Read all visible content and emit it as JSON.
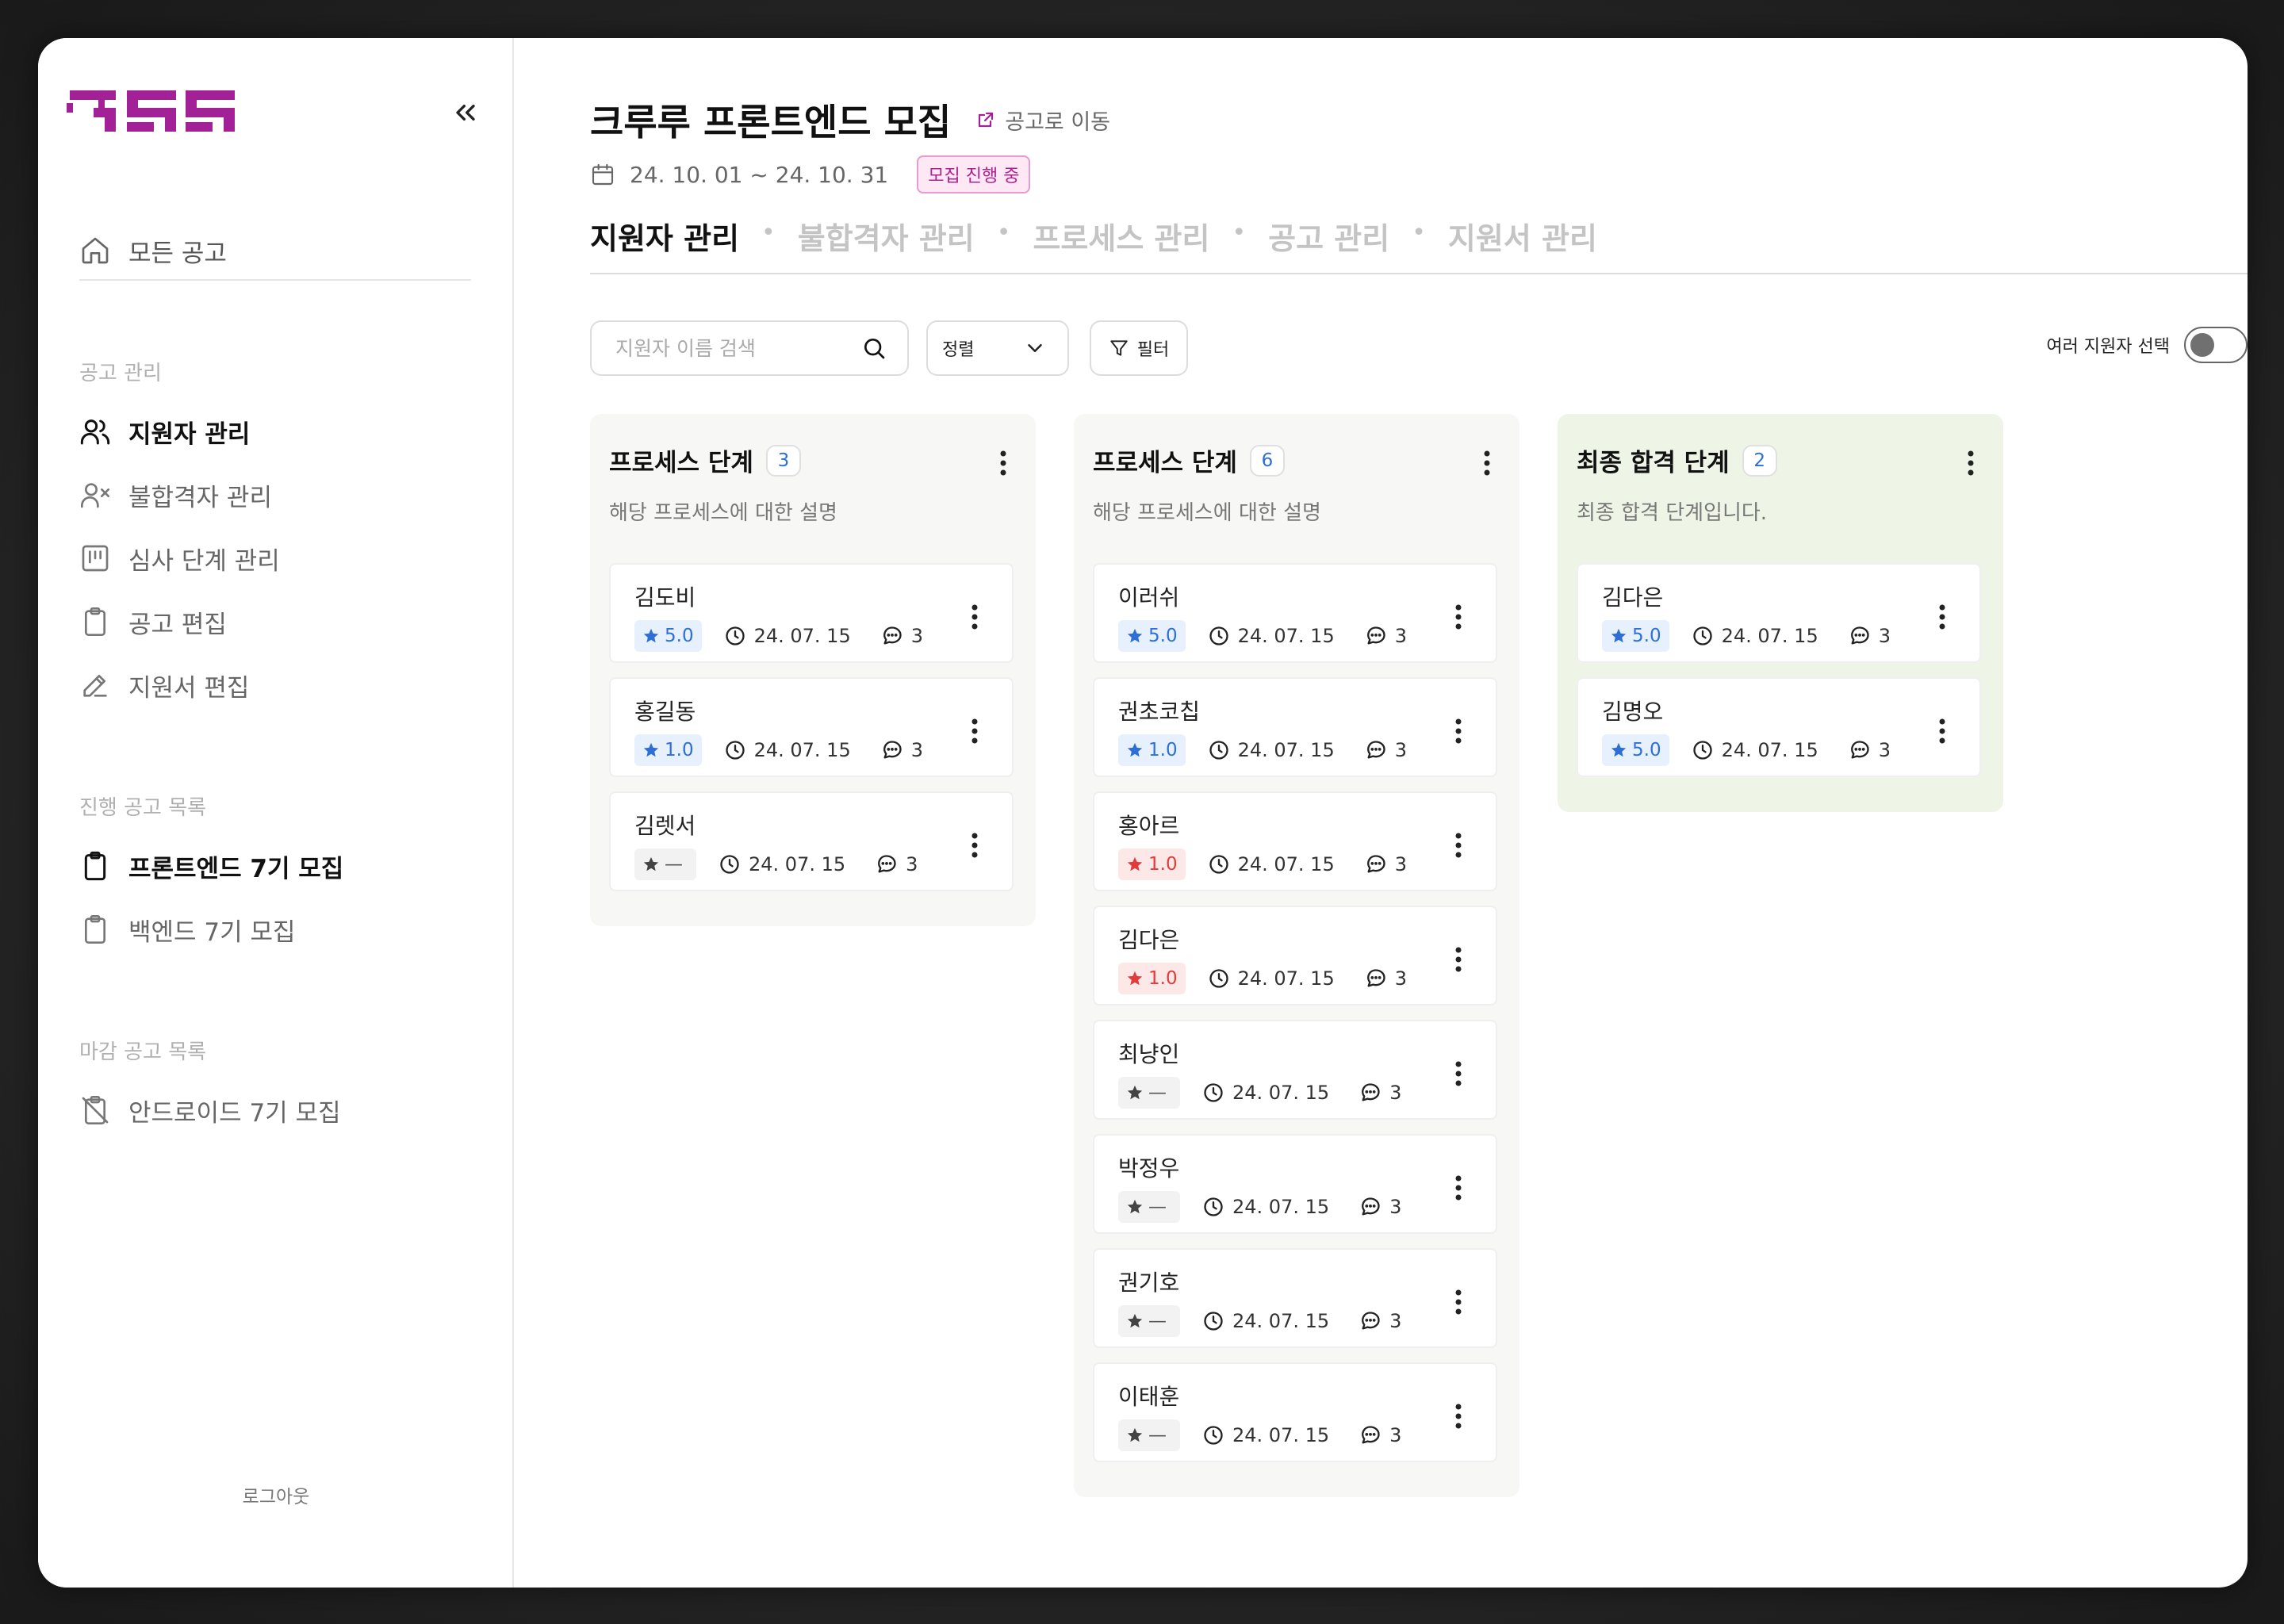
{
  "app": {
    "brand_color": "#a32196",
    "logo_label": "크루루"
  },
  "sidebar": {
    "collapse_icon": "double-chevron-left-icon",
    "home": {
      "label": "모든 공고",
      "icon": "home-icon"
    },
    "sections": [
      {
        "label": "공고 관리",
        "items": [
          {
            "label": "지원자 관리",
            "icon": "users-icon",
            "active": true
          },
          {
            "label": "불합격자 관리",
            "icon": "user-x-icon"
          },
          {
            "label": "심사 단계 관리",
            "icon": "kanban-icon"
          },
          {
            "label": "공고 편집",
            "icon": "clipboard-icon"
          },
          {
            "label": "지원서 편집",
            "icon": "pencil-icon"
          }
        ]
      },
      {
        "label": "진행 공고 목록",
        "items": [
          {
            "label": "프론트엔드 7기 모집",
            "icon": "clipboard-icon",
            "active": true
          },
          {
            "label": "백엔드 7기 모집",
            "icon": "clipboard-icon"
          }
        ]
      },
      {
        "label": "마감 공고 목록",
        "items": [
          {
            "label": "안드로이드 7기 모집",
            "icon": "clipboard-off-icon"
          }
        ]
      }
    ],
    "logout": "로그아웃"
  },
  "header": {
    "title": "크루루 프론트엔드 모집",
    "goto_link": "공고로 이동",
    "date_range": "24. 10. 01 ~ 24. 10. 31",
    "status_badge": "모집 진행 중"
  },
  "tabs": [
    {
      "label": "지원자 관리",
      "active": true
    },
    {
      "label": "불합격자 관리"
    },
    {
      "label": "프로세스 관리"
    },
    {
      "label": "공고 관리"
    },
    {
      "label": "지원서 관리"
    }
  ],
  "toolbar": {
    "search_placeholder": "지원자 이름 검색",
    "sort_label": "정렬",
    "filter_label": "필터",
    "multi_select_label": "여러 지원자 선택",
    "multi_select_on": false
  },
  "columns": [
    {
      "title": "프로세스 단계",
      "count": "3",
      "description": "해당 프로세스에 대한 설명",
      "final": false,
      "cards": [
        {
          "name": "김도비",
          "rating": "5.0",
          "rating_color": "blue",
          "date": "24. 07. 15",
          "comments": "3"
        },
        {
          "name": "홍길동",
          "rating": "1.0",
          "rating_color": "blue",
          "date": "24. 07. 15",
          "comments": "3"
        },
        {
          "name": "김렛서",
          "rating": "—",
          "rating_color": "gray",
          "date": "24. 07. 15",
          "comments": "3"
        }
      ]
    },
    {
      "title": "프로세스 단계",
      "count": "6",
      "description": "해당 프로세스에 대한 설명",
      "final": false,
      "cards": [
        {
          "name": "이러쉬",
          "rating": "5.0",
          "rating_color": "blue",
          "date": "24. 07. 15",
          "comments": "3"
        },
        {
          "name": "권초코칩",
          "rating": "1.0",
          "rating_color": "blue",
          "date": "24. 07. 15",
          "comments": "3"
        },
        {
          "name": "홍아르",
          "rating": "1.0",
          "rating_color": "red",
          "date": "24. 07. 15",
          "comments": "3"
        },
        {
          "name": "김다은",
          "rating": "1.0",
          "rating_color": "red",
          "date": "24. 07. 15",
          "comments": "3"
        },
        {
          "name": "최냥인",
          "rating": "—",
          "rating_color": "gray",
          "date": "24. 07. 15",
          "comments": "3"
        },
        {
          "name": "박정우",
          "rating": "—",
          "rating_color": "gray",
          "date": "24. 07. 15",
          "comments": "3"
        },
        {
          "name": "권기호",
          "rating": "—",
          "rating_color": "gray",
          "date": "24. 07. 15",
          "comments": "3"
        },
        {
          "name": "이태훈",
          "rating": "—",
          "rating_color": "gray",
          "date": "24. 07. 15",
          "comments": "3"
        }
      ]
    },
    {
      "title": "최종 합격 단계",
      "count": "2",
      "description": "최종 합격 단계입니다.",
      "final": true,
      "cards": [
        {
          "name": "김다은",
          "rating": "5.0",
          "rating_color": "blue",
          "date": "24. 07. 15",
          "comments": "3"
        },
        {
          "name": "김명오",
          "rating": "5.0",
          "rating_color": "blue",
          "date": "24. 07. 15",
          "comments": "3"
        }
      ]
    }
  ]
}
